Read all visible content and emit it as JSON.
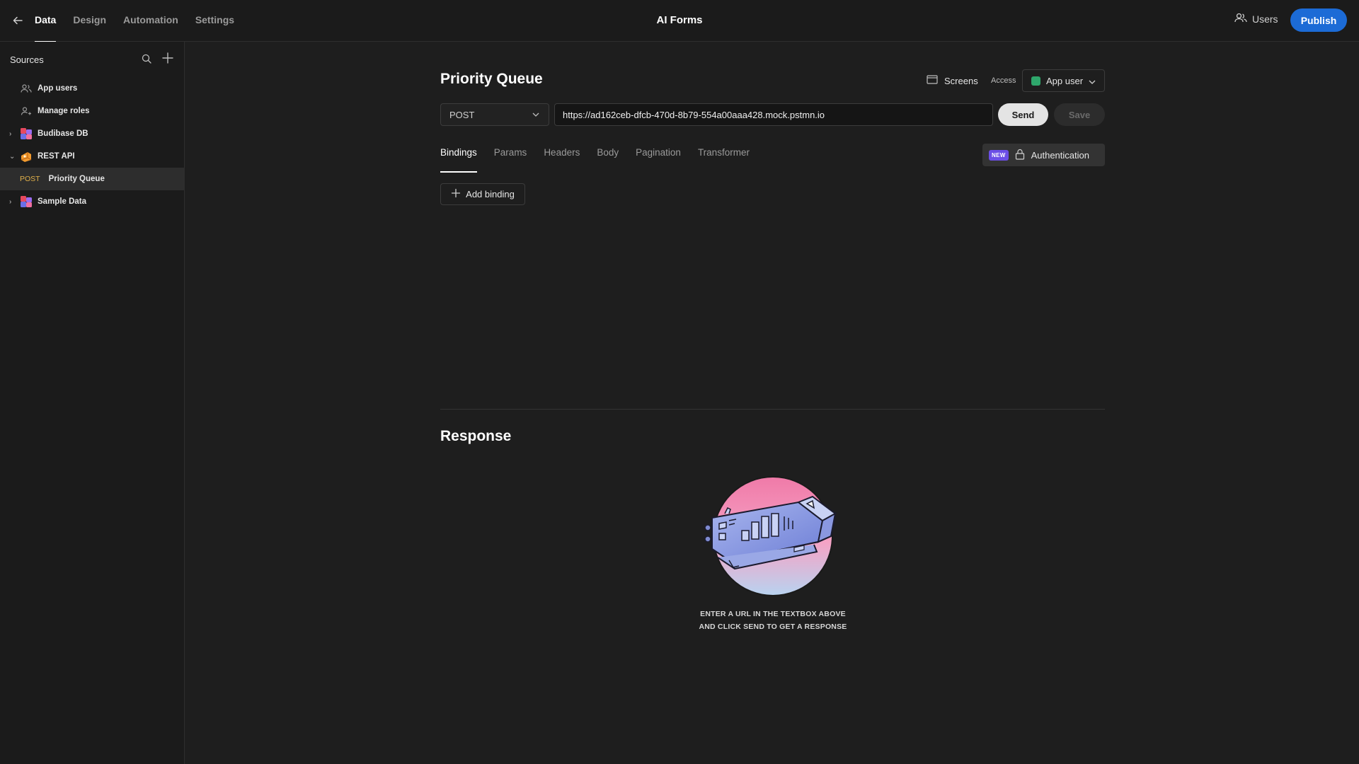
{
  "topbar": {
    "tabs": [
      {
        "label": "Data",
        "active": true
      },
      {
        "label": "Design",
        "active": false
      },
      {
        "label": "Automation",
        "active": false
      },
      {
        "label": "Settings",
        "active": false
      }
    ],
    "app_title": "AI Forms",
    "users_label": "Users",
    "publish_label": "Publish"
  },
  "sidebar": {
    "header": "Sources",
    "items": [
      {
        "label": "App users",
        "icon": "users-icon"
      },
      {
        "label": "Manage roles",
        "icon": "user-roles-icon"
      },
      {
        "label": "Budibase DB",
        "icon": "budibase-db-icon",
        "expandable": true,
        "expanded": false
      },
      {
        "label": "REST API",
        "icon": "rest-api-icon",
        "expandable": true,
        "expanded": true
      },
      {
        "label": "Priority Queue",
        "method": "POST",
        "selected": true
      },
      {
        "label": "Sample Data",
        "icon": "budibase-db-icon",
        "expandable": true,
        "expanded": false
      }
    ]
  },
  "query": {
    "title": "Priority Queue",
    "screens_label": "Screens",
    "access_label": "Access",
    "access_value": "App user",
    "access_color": "#2ea66b",
    "method": "POST",
    "url": "https://ad162ceb-dfcb-470d-8b79-554a00aaa428.mock.pstmn.io",
    "send_label": "Send",
    "save_label": "Save",
    "tabs": [
      {
        "label": "Bindings",
        "active": true
      },
      {
        "label": "Params",
        "active": false
      },
      {
        "label": "Headers",
        "active": false
      },
      {
        "label": "Body",
        "active": false
      },
      {
        "label": "Pagination",
        "active": false
      },
      {
        "label": "Transformer",
        "active": false
      }
    ],
    "auth_badge": "NEW",
    "auth_label": "Authentication",
    "add_binding_label": "Add binding"
  },
  "response": {
    "title": "Response",
    "empty_line1": "ENTER A URL IN THE TEXTBOX ABOVE",
    "empty_line2": "AND CLICK SEND TO GET A RESPONSE"
  },
  "colors": {
    "accent": "#1c6bd6",
    "new_badge": "#6b4ee6",
    "method_tag": "#e0b04a"
  }
}
